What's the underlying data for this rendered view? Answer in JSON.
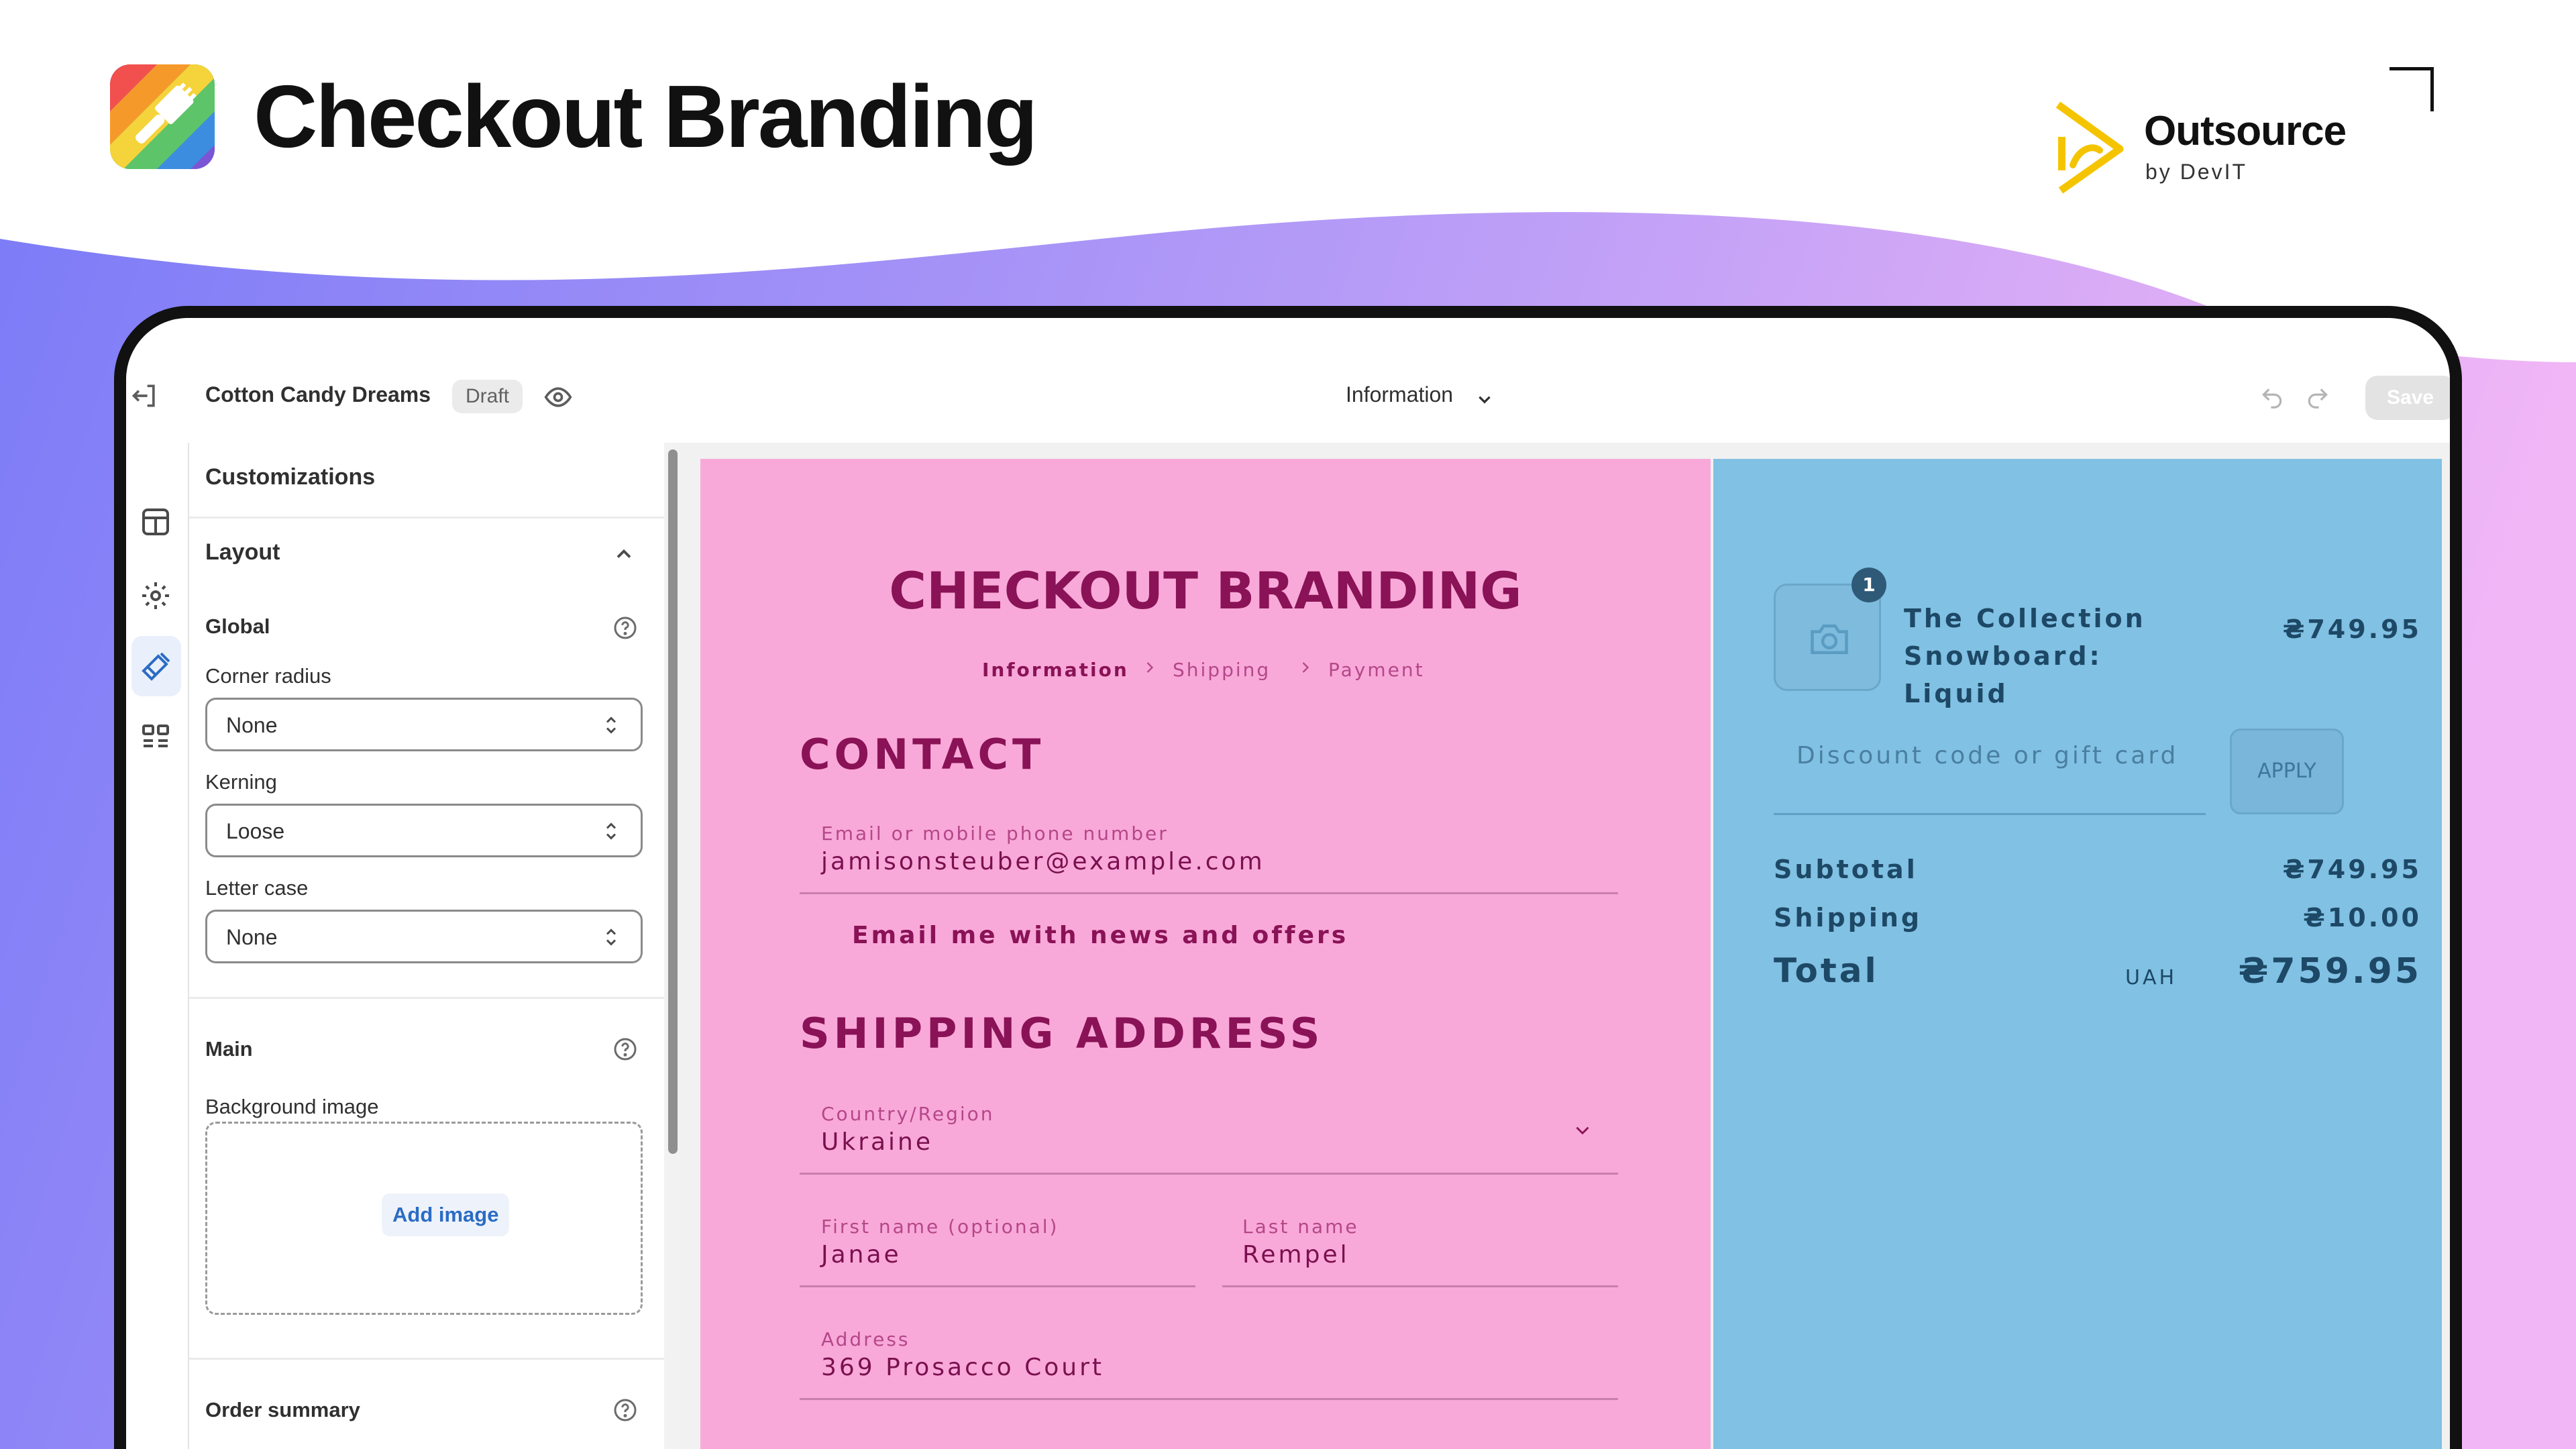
{
  "hero": {
    "title": "Checkout Branding",
    "brand_name": "Outsource",
    "brand_sub": "by DevIT"
  },
  "editor": {
    "theme_name": "Cotton Candy Dreams",
    "status": "Draft",
    "page_selector": "Information",
    "save_label": "Save"
  },
  "panel": {
    "heading": "Customizations",
    "layout_title": "Layout",
    "global_title": "Global",
    "corner_radius_label": "Corner radius",
    "corner_radius_value": "None",
    "kerning_label": "Kerning",
    "kerning_value": "Loose",
    "letter_case_label": "Letter case",
    "letter_case_value": "None",
    "main_title": "Main",
    "background_image_label": "Background image",
    "add_image_label": "Add image",
    "order_summary_title": "Order summary"
  },
  "checkout": {
    "title": "CHECKOUT BRANDING",
    "breadcrumbs": [
      "Information",
      "Shipping",
      "Payment"
    ],
    "contact_heading": "CONTACT",
    "email_label": "Email or mobile phone number",
    "email_value": "jamisonsteuber@example.com",
    "newsletter_label": "Email me with news and offers",
    "shipping_heading": "SHIPPING ADDRESS",
    "country_label": "Country/Region",
    "country_value": "Ukraine",
    "first_name_label": "First name (optional)",
    "first_name_value": "Janae",
    "last_name_label": "Last name",
    "last_name_value": "Rempel",
    "address_label": "Address",
    "address_value": "369 Prosacco Court"
  },
  "summary": {
    "quantity": "1",
    "product_name": "The Collection Snowboard: Liquid",
    "product_price": "₴749.95",
    "discount_placeholder": "Discount code or gift card",
    "apply_label": "APPLY",
    "subtotal_label": "Subtotal",
    "subtotal_value": "₴749.95",
    "shipping_label": "Shipping",
    "shipping_value": "₴10.00",
    "total_label": "Total",
    "currency": "UAH",
    "total_value": "₴759.95"
  },
  "colors": {
    "main_background": "#f9a9d9",
    "summary_background": "#81c1e3",
    "accent_text": "#8a1257",
    "summary_text": "#1d4866",
    "wave_start": "#7d7cf7",
    "wave_end": "#f1b6f6"
  }
}
